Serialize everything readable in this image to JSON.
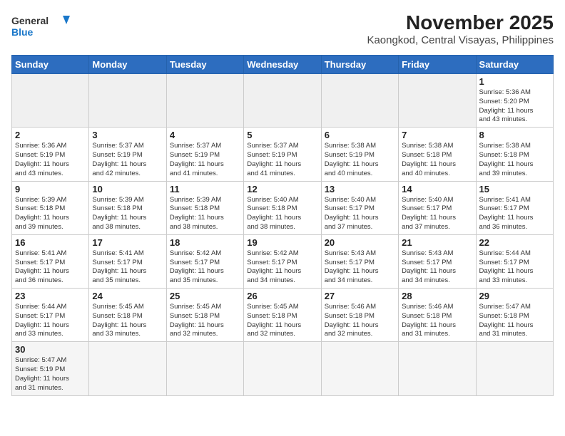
{
  "logo": {
    "text_general": "General",
    "text_blue": "Blue"
  },
  "title": "November 2025",
  "subtitle": "Kaongkod, Central Visayas, Philippines",
  "days_of_week": [
    "Sunday",
    "Monday",
    "Tuesday",
    "Wednesday",
    "Thursday",
    "Friday",
    "Saturday"
  ],
  "weeks": [
    [
      {
        "day": "",
        "info": ""
      },
      {
        "day": "",
        "info": ""
      },
      {
        "day": "",
        "info": ""
      },
      {
        "day": "",
        "info": ""
      },
      {
        "day": "",
        "info": ""
      },
      {
        "day": "",
        "info": ""
      },
      {
        "day": "1",
        "info": "Sunrise: 5:36 AM\nSunset: 5:20 PM\nDaylight: 11 hours\nand 43 minutes."
      }
    ],
    [
      {
        "day": "2",
        "info": "Sunrise: 5:36 AM\nSunset: 5:19 PM\nDaylight: 11 hours\nand 43 minutes."
      },
      {
        "day": "3",
        "info": "Sunrise: 5:37 AM\nSunset: 5:19 PM\nDaylight: 11 hours\nand 42 minutes."
      },
      {
        "day": "4",
        "info": "Sunrise: 5:37 AM\nSunset: 5:19 PM\nDaylight: 11 hours\nand 41 minutes."
      },
      {
        "day": "5",
        "info": "Sunrise: 5:37 AM\nSunset: 5:19 PM\nDaylight: 11 hours\nand 41 minutes."
      },
      {
        "day": "6",
        "info": "Sunrise: 5:38 AM\nSunset: 5:19 PM\nDaylight: 11 hours\nand 40 minutes."
      },
      {
        "day": "7",
        "info": "Sunrise: 5:38 AM\nSunset: 5:18 PM\nDaylight: 11 hours\nand 40 minutes."
      },
      {
        "day": "8",
        "info": "Sunrise: 5:38 AM\nSunset: 5:18 PM\nDaylight: 11 hours\nand 39 minutes."
      }
    ],
    [
      {
        "day": "9",
        "info": "Sunrise: 5:39 AM\nSunset: 5:18 PM\nDaylight: 11 hours\nand 39 minutes."
      },
      {
        "day": "10",
        "info": "Sunrise: 5:39 AM\nSunset: 5:18 PM\nDaylight: 11 hours\nand 38 minutes."
      },
      {
        "day": "11",
        "info": "Sunrise: 5:39 AM\nSunset: 5:18 PM\nDaylight: 11 hours\nand 38 minutes."
      },
      {
        "day": "12",
        "info": "Sunrise: 5:40 AM\nSunset: 5:18 PM\nDaylight: 11 hours\nand 38 minutes."
      },
      {
        "day": "13",
        "info": "Sunrise: 5:40 AM\nSunset: 5:17 PM\nDaylight: 11 hours\nand 37 minutes."
      },
      {
        "day": "14",
        "info": "Sunrise: 5:40 AM\nSunset: 5:17 PM\nDaylight: 11 hours\nand 37 minutes."
      },
      {
        "day": "15",
        "info": "Sunrise: 5:41 AM\nSunset: 5:17 PM\nDaylight: 11 hours\nand 36 minutes."
      }
    ],
    [
      {
        "day": "16",
        "info": "Sunrise: 5:41 AM\nSunset: 5:17 PM\nDaylight: 11 hours\nand 36 minutes."
      },
      {
        "day": "17",
        "info": "Sunrise: 5:41 AM\nSunset: 5:17 PM\nDaylight: 11 hours\nand 35 minutes."
      },
      {
        "day": "18",
        "info": "Sunrise: 5:42 AM\nSunset: 5:17 PM\nDaylight: 11 hours\nand 35 minutes."
      },
      {
        "day": "19",
        "info": "Sunrise: 5:42 AM\nSunset: 5:17 PM\nDaylight: 11 hours\nand 34 minutes."
      },
      {
        "day": "20",
        "info": "Sunrise: 5:43 AM\nSunset: 5:17 PM\nDaylight: 11 hours\nand 34 minutes."
      },
      {
        "day": "21",
        "info": "Sunrise: 5:43 AM\nSunset: 5:17 PM\nDaylight: 11 hours\nand 34 minutes."
      },
      {
        "day": "22",
        "info": "Sunrise: 5:44 AM\nSunset: 5:17 PM\nDaylight: 11 hours\nand 33 minutes."
      }
    ],
    [
      {
        "day": "23",
        "info": "Sunrise: 5:44 AM\nSunset: 5:17 PM\nDaylight: 11 hours\nand 33 minutes."
      },
      {
        "day": "24",
        "info": "Sunrise: 5:45 AM\nSunset: 5:18 PM\nDaylight: 11 hours\nand 33 minutes."
      },
      {
        "day": "25",
        "info": "Sunrise: 5:45 AM\nSunset: 5:18 PM\nDaylight: 11 hours\nand 32 minutes."
      },
      {
        "day": "26",
        "info": "Sunrise: 5:45 AM\nSunset: 5:18 PM\nDaylight: 11 hours\nand 32 minutes."
      },
      {
        "day": "27",
        "info": "Sunrise: 5:46 AM\nSunset: 5:18 PM\nDaylight: 11 hours\nand 32 minutes."
      },
      {
        "day": "28",
        "info": "Sunrise: 5:46 AM\nSunset: 5:18 PM\nDaylight: 11 hours\nand 31 minutes."
      },
      {
        "day": "29",
        "info": "Sunrise: 5:47 AM\nSunset: 5:18 PM\nDaylight: 11 hours\nand 31 minutes."
      }
    ],
    [
      {
        "day": "30",
        "info": "Sunrise: 5:47 AM\nSunset: 5:19 PM\nDaylight: 11 hours\nand 31 minutes."
      },
      {
        "day": "",
        "info": ""
      },
      {
        "day": "",
        "info": ""
      },
      {
        "day": "",
        "info": ""
      },
      {
        "day": "",
        "info": ""
      },
      {
        "day": "",
        "info": ""
      },
      {
        "day": "",
        "info": ""
      }
    ]
  ]
}
